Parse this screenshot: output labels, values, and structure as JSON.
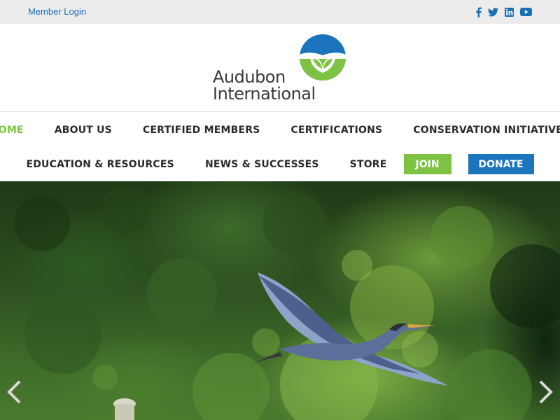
{
  "topbar": {
    "member_login": "Member Login",
    "socials": [
      "facebook-icon",
      "twitter-icon",
      "linkedin-icon",
      "youtube-icon"
    ],
    "social_color": "#1a6fb3"
  },
  "header": {
    "logo_line1": "Audubon",
    "logo_line2": "International"
  },
  "nav": {
    "row1": [
      "HOME",
      "ABOUT US",
      "CERTIFIED MEMBERS",
      "CERTIFICATIONS",
      "CONSERVATION INITIATIVES"
    ],
    "row2": [
      "EDUCATION & RESOURCES",
      "NEWS & SUCCESSES",
      "STORE"
    ],
    "join": "JOIN",
    "donate": "DONATE",
    "active": "HOME",
    "colors": {
      "active": "#7dc243",
      "join_bg": "#7dc243",
      "donate_bg": "#1b74bc"
    }
  },
  "hero": {
    "image": "great blue heron flying over green foliage",
    "prev_icon": "chevron-left-icon",
    "next_icon": "chevron-right-icon"
  }
}
